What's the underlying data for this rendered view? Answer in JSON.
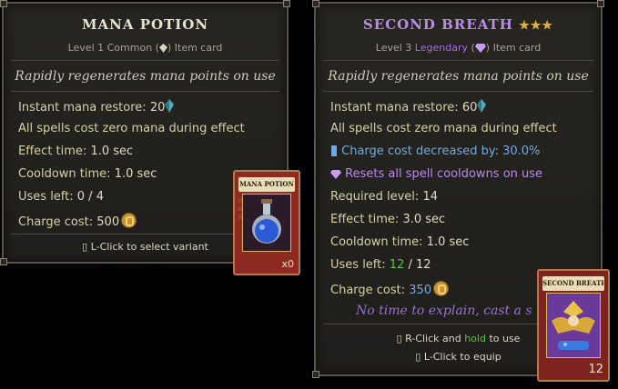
{
  "left_card": {
    "title": "MANA POTION",
    "sub_level": "Level 1",
    "sub_rarity": "Common",
    "sub_type": "Item card",
    "description": "Rapidly regenerates mana points on use",
    "stats": [
      {
        "label": "Instant mana restore:",
        "value": "20"
      },
      {
        "label": "All spells cost zero mana during effect"
      },
      {
        "label": "Effect time:",
        "value": "1.0 sec"
      },
      {
        "label": "Cooldown time:",
        "value": "1.0 sec"
      },
      {
        "label": "Uses left:",
        "value": "0 / 4"
      },
      {
        "label": "Charge cost:",
        "value": "500"
      }
    ],
    "footer": "L-Click to select variant",
    "thumb": {
      "banner": "MANA POTION",
      "count": "x0",
      "icon": "potion-flask-icon"
    },
    "title_color": "#e8e2cf"
  },
  "right_card": {
    "title": "SECOND BREATH",
    "stars": "★★★",
    "sub_level": "Level 3",
    "sub_rarity": "Legendary",
    "sub_type": "Item card",
    "description": "Rapidly regenerates mana points on use",
    "stats": [
      {
        "label": "Instant mana restore:",
        "value": "60"
      },
      {
        "label": "All spells cost zero mana during effect"
      },
      {
        "label": "Charge cost decreased by: 30.0%"
      },
      {
        "label": "Resets all spell cooldowns on use"
      },
      {
        "label": "Required level:",
        "value": "14"
      },
      {
        "label": "Effect time:",
        "value": "3.0 sec"
      },
      {
        "label": "Cooldown time:",
        "value": "1.0 sec"
      },
      {
        "label": "Uses left:",
        "value_current": "12",
        "value_sep": "/ 12"
      },
      {
        "label": "Charge cost:",
        "value": "350"
      }
    ],
    "flavor": "No time to explain, cast a s",
    "footer1_a": "R-Click and",
    "footer1_b": "hold",
    "footer1_c": "to use",
    "footer2": "L-Click to equip",
    "thumb": {
      "banner": "SECOND BREATH",
      "count": "12",
      "icon": "winged-hero-icon"
    },
    "title_color": "#b98ce8",
    "stars_color": "#e0b040"
  }
}
